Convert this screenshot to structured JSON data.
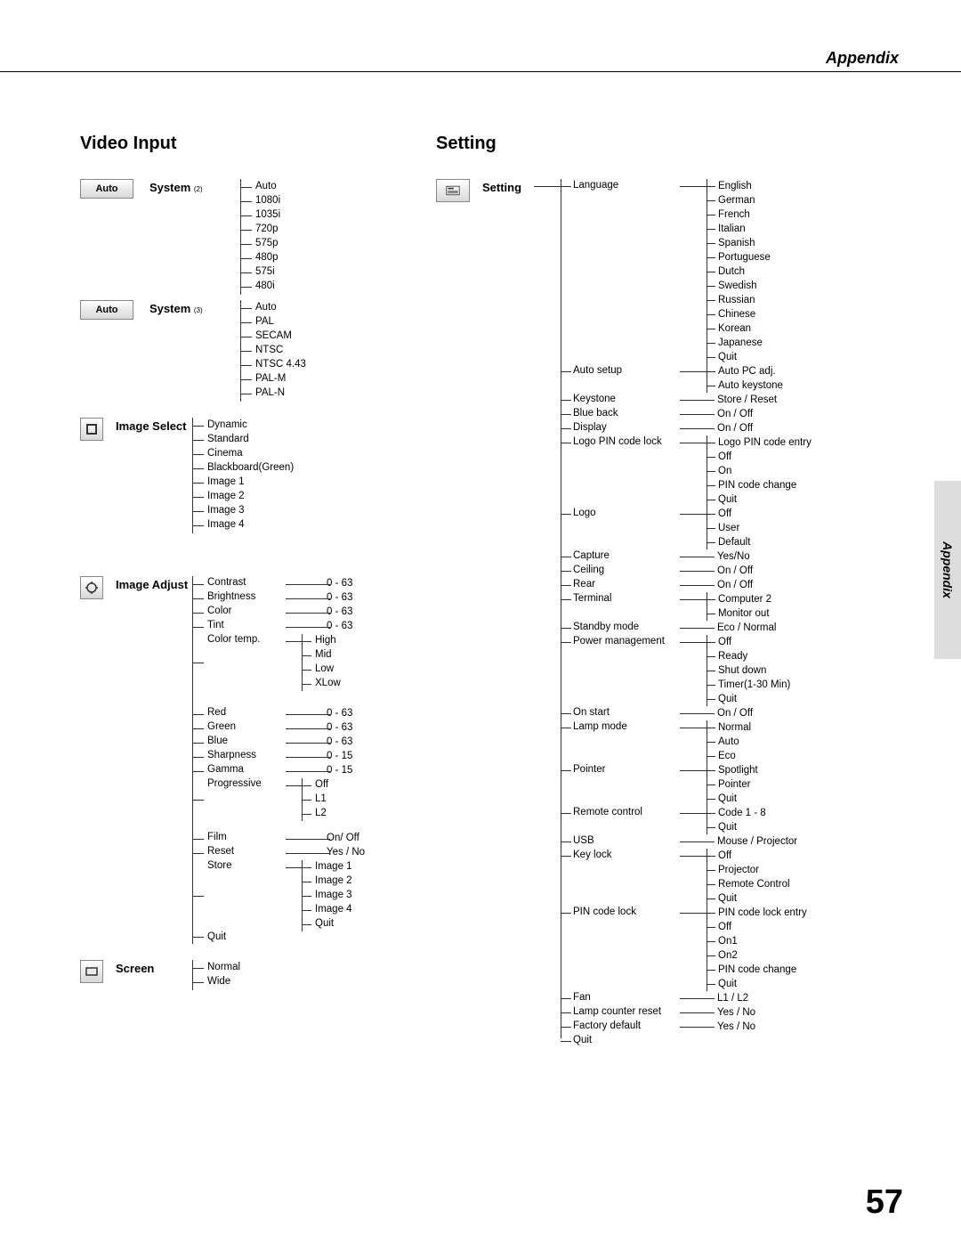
{
  "header": "Appendix",
  "side_tab": "Appendix",
  "page_number": "57",
  "video_input": {
    "title": "Video Input",
    "system2": {
      "icon_text": "Auto",
      "label": "System",
      "sub": "(2)",
      "items": [
        "Auto",
        "1080i",
        "1035i",
        "720p",
        "575p",
        "480p",
        "575i",
        "480i"
      ]
    },
    "system3": {
      "icon_text": "Auto",
      "label": "System",
      "sub": "(3)",
      "items": [
        "Auto",
        "PAL",
        "SECAM",
        "NTSC",
        "NTSC 4.43",
        "PAL-M",
        "PAL-N"
      ]
    },
    "image_select": {
      "label": "Image Select",
      "items": [
        "Dynamic",
        "Standard",
        "Cinema",
        "Blackboard(Green)",
        "Image 1",
        "Image 2",
        "Image 3",
        "Image 4"
      ]
    },
    "image_adjust": {
      "label": "Image Adjust",
      "rows": [
        {
          "name": "Contrast",
          "vals": [
            "0 - 63"
          ]
        },
        {
          "name": "Brightness",
          "vals": [
            "0 - 63"
          ]
        },
        {
          "name": "Color",
          "vals": [
            "0 - 63"
          ]
        },
        {
          "name": "Tint",
          "vals": [
            "0 - 63"
          ]
        },
        {
          "name": "Color temp.",
          "vals": [
            "High",
            "Mid",
            "Low",
            "XLow"
          ]
        },
        {
          "name": "Red",
          "vals": [
            "0 - 63"
          ]
        },
        {
          "name": "Green",
          "vals": [
            "0 - 63"
          ]
        },
        {
          "name": "Blue",
          "vals": [
            "0 - 63"
          ]
        },
        {
          "name": "Sharpness",
          "vals": [
            "0 - 15"
          ]
        },
        {
          "name": "Gamma",
          "vals": [
            "0 - 15"
          ]
        },
        {
          "name": "Progressive",
          "vals": [
            "Off",
            "L1",
            "L2"
          ]
        },
        {
          "name": "Film",
          "vals": [
            "On/ Off"
          ]
        },
        {
          "name": "Reset",
          "vals": [
            "Yes / No"
          ]
        },
        {
          "name": "Store",
          "vals": [
            "Image 1",
            "Image 2",
            "Image 3",
            "Image 4",
            "Quit"
          ]
        },
        {
          "name": "Quit",
          "vals": []
        }
      ]
    },
    "screen": {
      "label": "Screen",
      "items": [
        "Normal",
        "Wide"
      ]
    }
  },
  "setting": {
    "title": "Setting",
    "root_label": "Setting",
    "branches": [
      {
        "name": "Language",
        "vals": [
          "English",
          "German",
          "French",
          "Italian",
          "Spanish",
          "Portuguese",
          "Dutch",
          "Swedish",
          "Russian",
          "Chinese",
          "Korean",
          "Japanese",
          "Quit"
        ]
      },
      {
        "name": "Auto setup",
        "vals": [
          "Auto PC adj.",
          "Auto keystone"
        ]
      },
      {
        "name": "Keystone",
        "vals": [
          "Store / Reset"
        ]
      },
      {
        "name": "Blue back",
        "vals": [
          "On / Off"
        ]
      },
      {
        "name": "Display",
        "vals": [
          "On / Off"
        ]
      },
      {
        "name": "Logo PIN code lock",
        "vals": [
          "Logo PIN code entry",
          "Off",
          "On",
          "PIN code change",
          "Quit"
        ]
      },
      {
        "name": "Logo",
        "vals": [
          "Off",
          "User",
          "Default"
        ]
      },
      {
        "name": "Capture",
        "vals": [
          "Yes/No"
        ]
      },
      {
        "name": "Ceiling",
        "vals": [
          "On / Off"
        ]
      },
      {
        "name": "Rear",
        "vals": [
          "On / Off"
        ]
      },
      {
        "name": "Terminal",
        "vals": [
          "Computer 2",
          "Monitor out"
        ]
      },
      {
        "name": "Standby mode",
        "vals": [
          "Eco / Normal"
        ]
      },
      {
        "name": "Power management",
        "vals": [
          "Off",
          "Ready",
          "Shut down",
          "Timer(1-30 Min)",
          "Quit"
        ]
      },
      {
        "name": "On start",
        "vals": [
          "On / Off"
        ]
      },
      {
        "name": "Lamp mode",
        "vals": [
          "Normal",
          "Auto",
          "Eco"
        ]
      },
      {
        "name": "Pointer",
        "vals": [
          "Spotlight",
          "Pointer",
          "Quit"
        ]
      },
      {
        "name": "Remote control",
        "vals": [
          "Code 1 - 8",
          "Quit"
        ]
      },
      {
        "name": "USB",
        "vals": [
          "Mouse / Projector"
        ]
      },
      {
        "name": "Key lock",
        "vals": [
          "Off",
          "Projector",
          "Remote Control",
          "Quit"
        ]
      },
      {
        "name": "PIN code lock",
        "vals": [
          "PIN code lock entry",
          "Off",
          "On1",
          "On2",
          "PIN code change",
          "Quit"
        ]
      },
      {
        "name": "Fan",
        "vals": [
          "L1 / L2"
        ]
      },
      {
        "name": "Lamp counter reset",
        "vals": [
          "Yes / No"
        ]
      },
      {
        "name": "Factory default",
        "vals": [
          "Yes / No"
        ]
      },
      {
        "name": "Quit",
        "vals": []
      }
    ]
  }
}
